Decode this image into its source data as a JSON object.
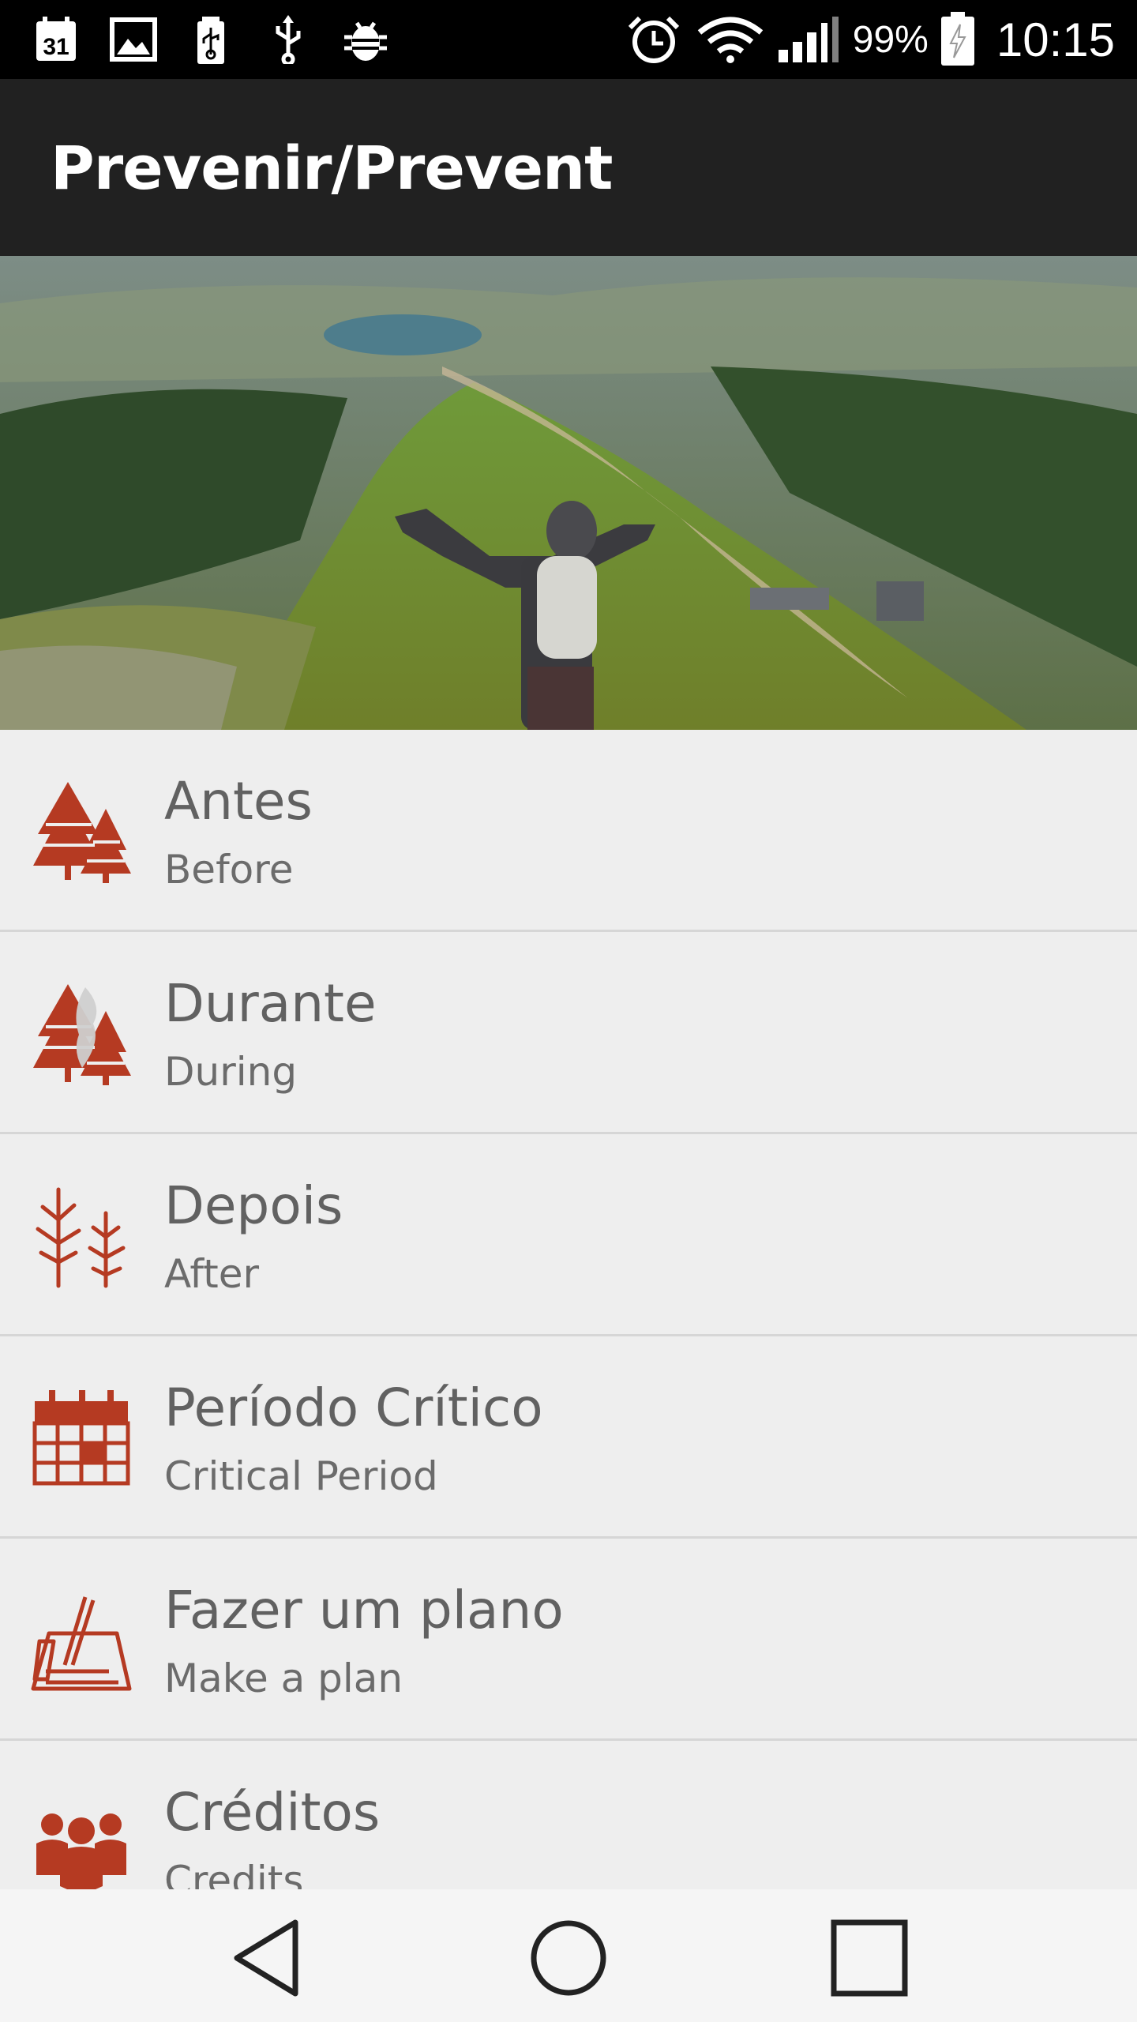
{
  "status_bar": {
    "left_icons": [
      "calendar-icon",
      "image-icon",
      "usb-battery-icon",
      "usb-icon",
      "debug-android-icon"
    ],
    "calendar_day": "31",
    "right_icons": [
      "alarm-icon",
      "wifi-icon",
      "signal-icon",
      "battery-charging-icon"
    ],
    "battery_percent": "99%",
    "time": "10:15"
  },
  "app_bar": {
    "title": "Prevenir/Prevent"
  },
  "hero": {
    "description_icon": "hero-mountain-image"
  },
  "list": {
    "items": [
      {
        "title": "Antes",
        "subtitle": "Before",
        "icon": "trees-icon"
      },
      {
        "title": "Durante",
        "subtitle": "During",
        "icon": "trees-smoke-icon"
      },
      {
        "title": "Depois",
        "subtitle": "After",
        "icon": "burnt-trees-icon"
      },
      {
        "title": "Período Crítico",
        "subtitle": "Critical Period",
        "icon": "calendar-grid-icon"
      },
      {
        "title": "Fazer um plano",
        "subtitle": "Make a plan",
        "icon": "plan-pencil-icon"
      },
      {
        "title": "Créditos",
        "subtitle": "Credits",
        "icon": "people-group-icon"
      }
    ]
  },
  "nav_bar": {
    "icons": [
      "back-icon",
      "home-icon",
      "recents-icon"
    ]
  },
  "colors": {
    "accent_icon": "#b53a22",
    "app_bar": "#212121",
    "status_bar": "#000000",
    "list_bg": "#eeeeee",
    "title_text": "#616161"
  }
}
